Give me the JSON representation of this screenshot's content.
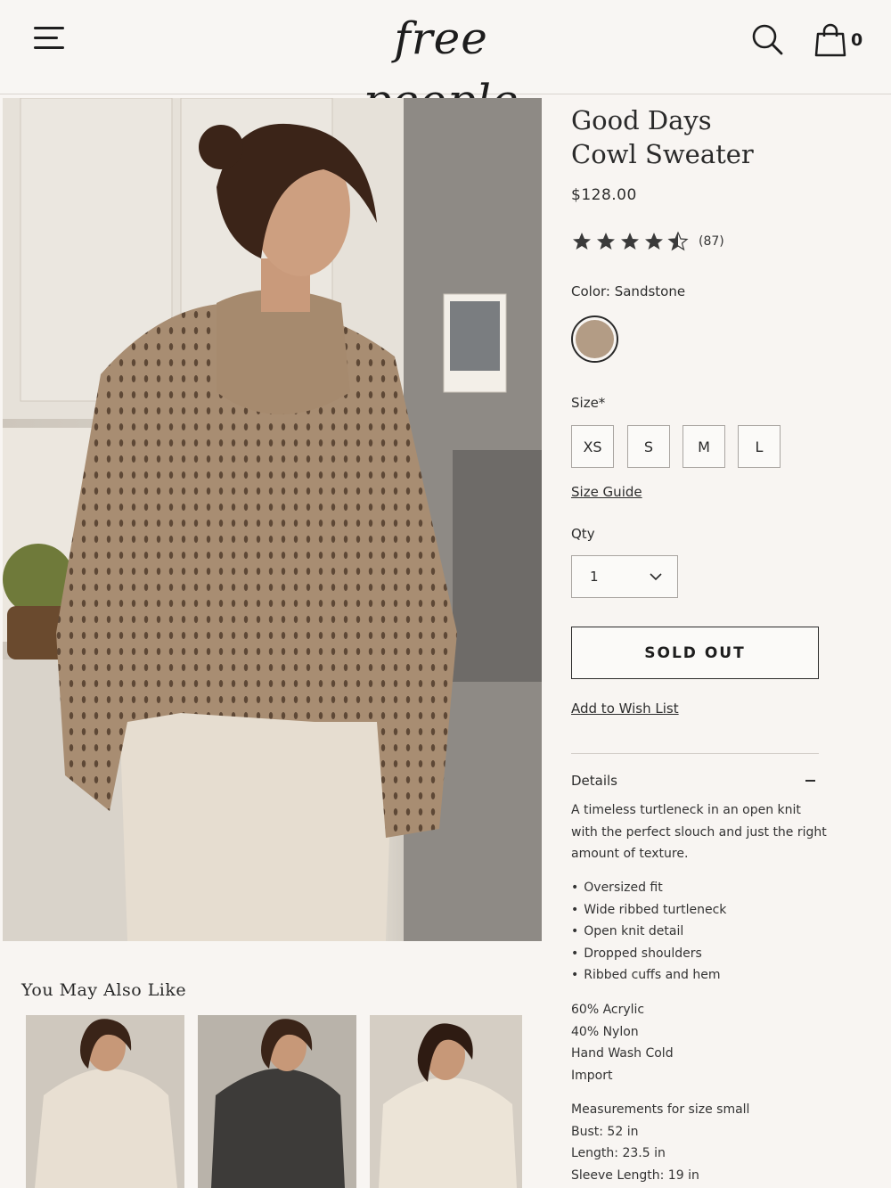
{
  "header": {
    "logo": "free people",
    "cart_count": "0"
  },
  "product": {
    "title_line1": "Good Days",
    "title_line2": "Cowl Sweater",
    "price": "$128.00",
    "rating": 4.5,
    "review_count": "(87)",
    "color_label": "Color: Sandstone",
    "swatch_color": "#b39c85",
    "size_label": "Size*",
    "sizes": [
      "XS",
      "S",
      "M",
      "L"
    ],
    "size_guide": "Size Guide",
    "qty_label": "Qty",
    "qty_value": "1",
    "sold_out": "SOLD OUT",
    "wishlist": "Add to Wish List"
  },
  "details": {
    "title": "Details",
    "description": "A timeless turtleneck in an open knit with the perfect slouch and just the right amount of texture.",
    "bullets": [
      "Oversized fit",
      "Wide ribbed turtleneck",
      "Open knit detail",
      "Dropped shoulders",
      "Ribbed cuffs and hem"
    ],
    "specs": [
      "60% Acrylic",
      "40% Nylon",
      "Hand Wash Cold",
      "Import"
    ],
    "measurements": [
      "Measurements for size small",
      "Bust: 52 in",
      "Length: 23.5 in",
      "Sleeve Length: 19 in"
    ]
  },
  "ymal": {
    "title": "You May Also Like",
    "items": [
      {
        "color": "#e8dfd2"
      },
      {
        "color": "#3d3b39"
      },
      {
        "color": "#ece4d7"
      }
    ]
  }
}
